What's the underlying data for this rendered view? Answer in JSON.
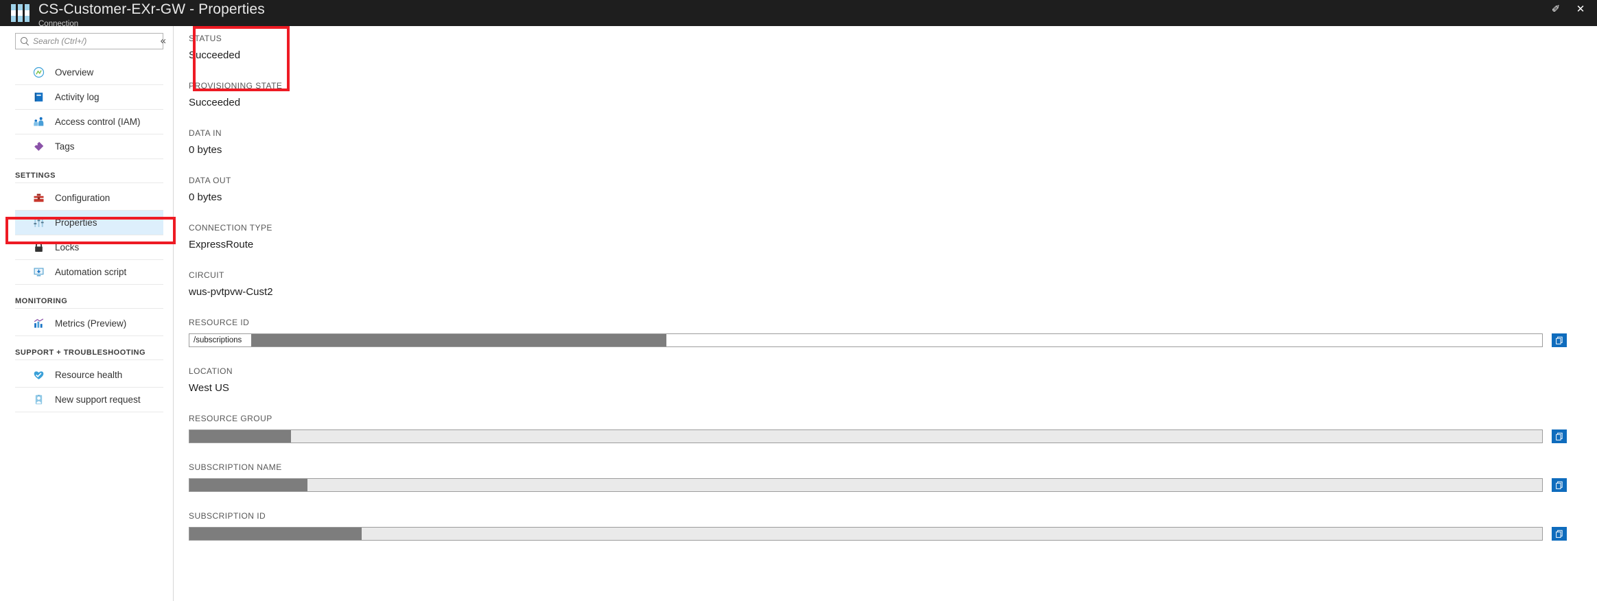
{
  "window": {
    "title": "CS-Customer-EXr-GW - Properties",
    "subtitle": "Connection",
    "pin_label": "✐",
    "close_label": "✕",
    "app_icon": "connection-icon",
    "accent_color": "#0f6cbd",
    "header_bg": "#1e1e1e",
    "annotation_color": "#ee1b24"
  },
  "search": {
    "placeholder": "Search (Ctrl+/)",
    "value": "",
    "icon": "search-icon"
  },
  "collapse": {
    "label": "«",
    "icon": "chevron-double-left-icon"
  },
  "sidebar": {
    "groups": [
      {
        "header": "",
        "items": [
          {
            "label": "Overview",
            "icon": "overview-icon",
            "selected": false
          },
          {
            "label": "Activity log",
            "icon": "activity-log-icon",
            "selected": false
          },
          {
            "label": "Access control (IAM)",
            "icon": "access-control-icon",
            "selected": false
          },
          {
            "label": "Tags",
            "icon": "tag-icon",
            "selected": false
          }
        ]
      },
      {
        "header": "SETTINGS",
        "items": [
          {
            "label": "Configuration",
            "icon": "toolbox-icon",
            "selected": false
          },
          {
            "label": "Properties",
            "icon": "sliders-icon",
            "selected": true
          },
          {
            "label": "Locks",
            "icon": "lock-icon",
            "selected": false
          },
          {
            "label": "Automation script",
            "icon": "automation-script-icon",
            "selected": false
          }
        ]
      },
      {
        "header": "MONITORING",
        "items": [
          {
            "label": "Metrics (Preview)",
            "icon": "metrics-chart-icon",
            "selected": false
          }
        ]
      },
      {
        "header": "SUPPORT + TROUBLESHOOTING",
        "items": [
          {
            "label": "Resource health",
            "icon": "heart-health-icon",
            "selected": false
          },
          {
            "label": "New support request",
            "icon": "support-request-icon",
            "selected": false
          }
        ]
      }
    ]
  },
  "properties": {
    "status": {
      "label": "STATUS",
      "value": "Succeeded"
    },
    "provisioning_state": {
      "label": "PROVISIONING STATE",
      "value": "Succeeded"
    },
    "data_in": {
      "label": "DATA IN",
      "value": "0 bytes"
    },
    "data_out": {
      "label": "DATA OUT",
      "value": "0 bytes"
    },
    "connection_type": {
      "label": "CONNECTION TYPE",
      "value": "ExpressRoute"
    },
    "circuit": {
      "label": "CIRCUIT",
      "value": "wus-pvtpvw-Cust2"
    },
    "resource_id": {
      "label": "RESOURCE ID",
      "value": "/subscriptions",
      "redacted": true
    },
    "location": {
      "label": "LOCATION",
      "value": "West US"
    },
    "resource_group": {
      "label": "RESOURCE GROUP",
      "value": "",
      "redacted": true
    },
    "subscription_name": {
      "label": "SUBSCRIPTION NAME",
      "value": "",
      "redacted": true
    },
    "subscription_id": {
      "label": "SUBSCRIPTION ID",
      "value": "",
      "redacted": true
    }
  },
  "copy_button": {
    "icon": "copy-icon",
    "title": "Copy to clipboard"
  }
}
